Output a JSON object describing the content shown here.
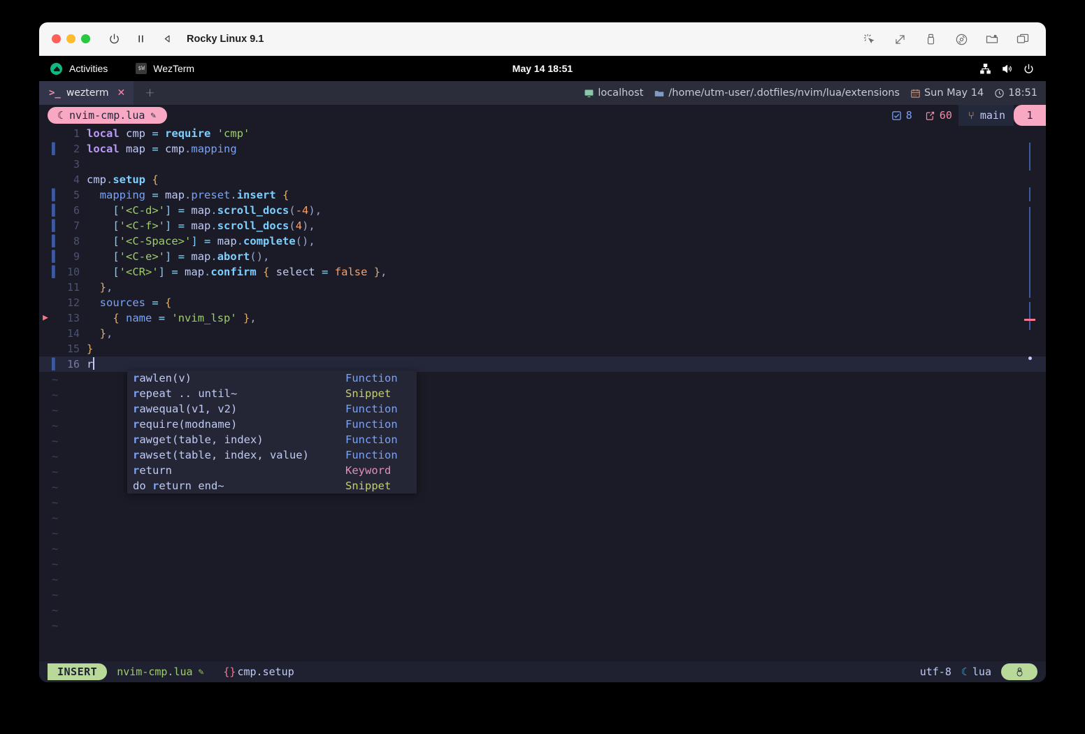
{
  "vm": {
    "title": "Rocky Linux 9.1",
    "toolbar_left_icons": [
      "power-icon",
      "pause-icon",
      "rewind-icon"
    ],
    "toolbar_right_icons": [
      "cursor-capture-icon",
      "resize-icon",
      "usb-icon",
      "disk-icon",
      "shared-folder-icon",
      "windows-icon"
    ]
  },
  "gnome": {
    "activities": "Activities",
    "app_name": "WezTerm",
    "clock": "May 14  18:51",
    "tray_icons": [
      "network-icon",
      "volume-icon",
      "power-icon"
    ]
  },
  "wezterm": {
    "tab_label": "wezterm",
    "prompt_glyph": ">_",
    "close_glyph": "✕",
    "new_tab_glyph": "+",
    "status": {
      "host": "localhost",
      "path": "/home/utm-user/.dotfiles/nvim/lua/extensions",
      "date": "Sun May 14",
      "time": "18:51"
    }
  },
  "bufferline": {
    "buffer_name": "nvim-cmp.lua",
    "modified_glyph": "✎",
    "lua_glyph": "☾",
    "diagnostics_count": "8",
    "changes_count": "60",
    "branch": "main",
    "badge": "1"
  },
  "editor": {
    "lines": [
      {
        "n": "1",
        "gitsign": false,
        "sign": "",
        "tokens": [
          {
            "t": "local",
            "c": "kw"
          },
          {
            "t": " ",
            "c": "ident"
          },
          {
            "t": "cmp",
            "c": "ident"
          },
          {
            "t": " ",
            "c": "ident"
          },
          {
            "t": "=",
            "c": "op"
          },
          {
            "t": " ",
            "c": "ident"
          },
          {
            "t": "require",
            "c": "fn"
          },
          {
            "t": " ",
            "c": "ident"
          },
          {
            "t": "'cmp'",
            "c": "str"
          }
        ]
      },
      {
        "n": "2",
        "gitsign": true,
        "sign": "",
        "tokens": [
          {
            "t": "local",
            "c": "kw"
          },
          {
            "t": " ",
            "c": "ident"
          },
          {
            "t": "map",
            "c": "ident"
          },
          {
            "t": " ",
            "c": "ident"
          },
          {
            "t": "=",
            "c": "op"
          },
          {
            "t": " ",
            "c": "ident"
          },
          {
            "t": "cmp",
            "c": "ident"
          },
          {
            "t": ".",
            "c": "punct"
          },
          {
            "t": "mapping",
            "c": "prop"
          }
        ]
      },
      {
        "n": "3",
        "gitsign": false,
        "sign": "",
        "tokens": []
      },
      {
        "n": "4",
        "gitsign": false,
        "sign": "",
        "tokens": [
          {
            "t": "cmp",
            "c": "ident"
          },
          {
            "t": ".",
            "c": "punct"
          },
          {
            "t": "setup",
            "c": "fn"
          },
          {
            "t": " ",
            "c": "ident"
          },
          {
            "t": "{",
            "c": "brace"
          }
        ]
      },
      {
        "n": "5",
        "gitsign": true,
        "sign": "",
        "tokens": [
          {
            "t": "  ",
            "c": "ident"
          },
          {
            "t": "mapping",
            "c": "prop"
          },
          {
            "t": " ",
            "c": "ident"
          },
          {
            "t": "=",
            "c": "op"
          },
          {
            "t": " ",
            "c": "ident"
          },
          {
            "t": "map",
            "c": "ident"
          },
          {
            "t": ".",
            "c": "punct"
          },
          {
            "t": "preset",
            "c": "prop"
          },
          {
            "t": ".",
            "c": "punct"
          },
          {
            "t": "insert",
            "c": "fn"
          },
          {
            "t": " ",
            "c": "ident"
          },
          {
            "t": "{",
            "c": "brace"
          }
        ]
      },
      {
        "n": "6",
        "gitsign": true,
        "sign": "",
        "tokens": [
          {
            "t": "    ",
            "c": "ident"
          },
          {
            "t": "[",
            "c": "bracket"
          },
          {
            "t": "'<C-d>'",
            "c": "str"
          },
          {
            "t": "]",
            "c": "bracket"
          },
          {
            "t": " ",
            "c": "ident"
          },
          {
            "t": "=",
            "c": "op"
          },
          {
            "t": " ",
            "c": "ident"
          },
          {
            "t": "map",
            "c": "ident"
          },
          {
            "t": ".",
            "c": "punct"
          },
          {
            "t": "scroll_docs",
            "c": "fn"
          },
          {
            "t": "(",
            "c": "punct"
          },
          {
            "t": "-4",
            "c": "num"
          },
          {
            "t": ")",
            "c": "punct"
          },
          {
            "t": ",",
            "c": "punct"
          }
        ]
      },
      {
        "n": "7",
        "gitsign": true,
        "sign": "",
        "tokens": [
          {
            "t": "    ",
            "c": "ident"
          },
          {
            "t": "[",
            "c": "bracket"
          },
          {
            "t": "'<C-f>'",
            "c": "str"
          },
          {
            "t": "]",
            "c": "bracket"
          },
          {
            "t": " ",
            "c": "ident"
          },
          {
            "t": "=",
            "c": "op"
          },
          {
            "t": " ",
            "c": "ident"
          },
          {
            "t": "map",
            "c": "ident"
          },
          {
            "t": ".",
            "c": "punct"
          },
          {
            "t": "scroll_docs",
            "c": "fn"
          },
          {
            "t": "(",
            "c": "punct"
          },
          {
            "t": "4",
            "c": "num"
          },
          {
            "t": ")",
            "c": "punct"
          },
          {
            "t": ",",
            "c": "punct"
          }
        ]
      },
      {
        "n": "8",
        "gitsign": true,
        "sign": "",
        "tokens": [
          {
            "t": "    ",
            "c": "ident"
          },
          {
            "t": "[",
            "c": "bracket"
          },
          {
            "t": "'<C-Space>'",
            "c": "str"
          },
          {
            "t": "]",
            "c": "bracket"
          },
          {
            "t": " ",
            "c": "ident"
          },
          {
            "t": "=",
            "c": "op"
          },
          {
            "t": " ",
            "c": "ident"
          },
          {
            "t": "map",
            "c": "ident"
          },
          {
            "t": ".",
            "c": "punct"
          },
          {
            "t": "complete",
            "c": "fn"
          },
          {
            "t": "()",
            "c": "punct"
          },
          {
            "t": ",",
            "c": "punct"
          }
        ]
      },
      {
        "n": "9",
        "gitsign": true,
        "sign": "",
        "tokens": [
          {
            "t": "    ",
            "c": "ident"
          },
          {
            "t": "[",
            "c": "bracket"
          },
          {
            "t": "'<C-e>'",
            "c": "str"
          },
          {
            "t": "]",
            "c": "bracket"
          },
          {
            "t": " ",
            "c": "ident"
          },
          {
            "t": "=",
            "c": "op"
          },
          {
            "t": " ",
            "c": "ident"
          },
          {
            "t": "map",
            "c": "ident"
          },
          {
            "t": ".",
            "c": "punct"
          },
          {
            "t": "abort",
            "c": "fn"
          },
          {
            "t": "()",
            "c": "punct"
          },
          {
            "t": ",",
            "c": "punct"
          }
        ]
      },
      {
        "n": "10",
        "gitsign": true,
        "sign": "",
        "tokens": [
          {
            "t": "    ",
            "c": "ident"
          },
          {
            "t": "[",
            "c": "bracket"
          },
          {
            "t": "'<CR>'",
            "c": "str"
          },
          {
            "t": "]",
            "c": "bracket"
          },
          {
            "t": " ",
            "c": "ident"
          },
          {
            "t": "=",
            "c": "op"
          },
          {
            "t": " ",
            "c": "ident"
          },
          {
            "t": "map",
            "c": "ident"
          },
          {
            "t": ".",
            "c": "punct"
          },
          {
            "t": "confirm",
            "c": "fn"
          },
          {
            "t": " ",
            "c": "ident"
          },
          {
            "t": "{",
            "c": "brace"
          },
          {
            "t": " ",
            "c": "ident"
          },
          {
            "t": "select",
            "c": "ident"
          },
          {
            "t": " ",
            "c": "ident"
          },
          {
            "t": "=",
            "c": "op"
          },
          {
            "t": " ",
            "c": "ident"
          },
          {
            "t": "false",
            "c": "bool"
          },
          {
            "t": " ",
            "c": "ident"
          },
          {
            "t": "}",
            "c": "brace"
          },
          {
            "t": ",",
            "c": "punct"
          }
        ]
      },
      {
        "n": "11",
        "gitsign": false,
        "sign": "",
        "tokens": [
          {
            "t": "  ",
            "c": "ident"
          },
          {
            "t": "}",
            "c": "brace"
          },
          {
            "t": ",",
            "c": "punct"
          }
        ]
      },
      {
        "n": "12",
        "gitsign": false,
        "sign": "",
        "tokens": [
          {
            "t": "  ",
            "c": "ident"
          },
          {
            "t": "sources",
            "c": "prop"
          },
          {
            "t": " ",
            "c": "ident"
          },
          {
            "t": "=",
            "c": "op"
          },
          {
            "t": " ",
            "c": "ident"
          },
          {
            "t": "{",
            "c": "brace"
          }
        ]
      },
      {
        "n": "13",
        "gitsign": false,
        "sign": "▶",
        "tokens": [
          {
            "t": "    ",
            "c": "ident"
          },
          {
            "t": "{",
            "c": "brace"
          },
          {
            "t": " ",
            "c": "ident"
          },
          {
            "t": "name",
            "c": "prop"
          },
          {
            "t": " ",
            "c": "ident"
          },
          {
            "t": "=",
            "c": "op"
          },
          {
            "t": " ",
            "c": "ident"
          },
          {
            "t": "'nvim_lsp'",
            "c": "str"
          },
          {
            "t": " ",
            "c": "ident"
          },
          {
            "t": "}",
            "c": "brace"
          },
          {
            "t": ",",
            "c": "punct"
          }
        ]
      },
      {
        "n": "14",
        "gitsign": false,
        "sign": "",
        "tokens": [
          {
            "t": "  ",
            "c": "ident"
          },
          {
            "t": "}",
            "c": "brace"
          },
          {
            "t": ",",
            "c": "punct"
          }
        ]
      },
      {
        "n": "15",
        "gitsign": false,
        "sign": "",
        "tokens": [
          {
            "t": "}",
            "c": "brace"
          }
        ]
      },
      {
        "n": "16",
        "gitsign": true,
        "sign": "",
        "cursorline": true,
        "cursor": true,
        "tokens": [
          {
            "t": "r",
            "c": "ident"
          }
        ]
      }
    ],
    "empty_marker": "~",
    "empty_line_count": 17
  },
  "completion": {
    "items": [
      {
        "match": "r",
        "rest": "awlen(v)",
        "kind": "Function"
      },
      {
        "match": "r",
        "rest": "epeat .. until~",
        "kind": "Snippet"
      },
      {
        "match": "r",
        "rest": "awequal(v1, v2)",
        "kind": "Function"
      },
      {
        "match": "r",
        "rest": "equire(modname)",
        "kind": "Function"
      },
      {
        "match": "r",
        "rest": "awget(table, index)",
        "kind": "Function"
      },
      {
        "match": "r",
        "rest": "awset(table, index, value)",
        "kind": "Function"
      },
      {
        "match": "r",
        "rest": "eturn",
        "kind": "Keyword"
      },
      {
        "prefix": "do ",
        "match": "r",
        "rest": "eturn end~",
        "kind": "Snippet"
      }
    ]
  },
  "statusline": {
    "mode": "INSERT",
    "filename": "nvim-cmp.lua",
    "modified_glyph": "✎",
    "context_braces": "{}",
    "context": "cmp.setup",
    "encoding": "utf-8",
    "filetype": "lua",
    "lua_glyph": "☾",
    "os_glyph": "🐧"
  },
  "colors": {
    "bg": "#1a1b26",
    "accent_pink": "#f9a8c4",
    "accent_green": "#b9d99a",
    "blue": "#7aa2f7",
    "red": "#f7768e"
  }
}
